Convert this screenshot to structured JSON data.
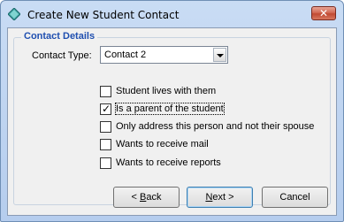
{
  "window": {
    "title": "Create New Student Contact",
    "close_glyph": "✕"
  },
  "group": {
    "title": "Contact Details"
  },
  "contact_type": {
    "label": "Contact Type:",
    "value": "Contact 2"
  },
  "checkboxes": [
    {
      "label": "Student lives with them",
      "checked": false
    },
    {
      "label": "Is a parent of the student",
      "checked": true
    },
    {
      "label": "Only address this person and not their spouse",
      "checked": false
    },
    {
      "label": "Wants to receive mail",
      "checked": false
    },
    {
      "label": "Wants to receive reports",
      "checked": false
    }
  ],
  "buttons": {
    "back": {
      "mnemonic": "B",
      "pre": "< ",
      "post": "ack"
    },
    "next": {
      "mnemonic": "N",
      "pre": "",
      "post": "ext >"
    },
    "cancel": {
      "label": "Cancel"
    }
  },
  "icons": {
    "app": "diamond-app-icon",
    "checkmark": "✓"
  }
}
